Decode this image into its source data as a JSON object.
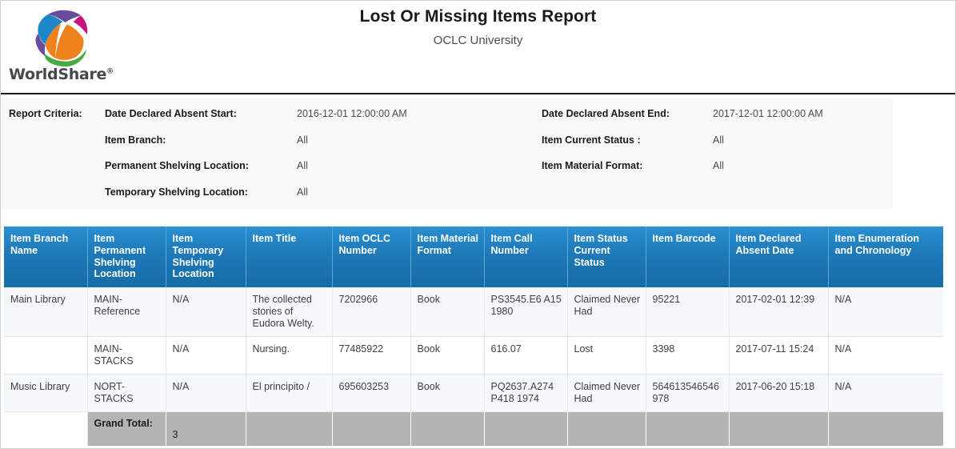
{
  "brand": {
    "name": "WorldShare",
    "trademark": "®",
    "logo_icon": "worldshare-globe-logo",
    "colors": {
      "blue": "#1b87c9",
      "orange": "#f0821e",
      "green": "#49a942",
      "purple": "#6b4c9a",
      "magenta": "#c4167e",
      "wordmark": "#44484d"
    }
  },
  "header": {
    "title": "Lost Or Missing Items Report",
    "subtitle": "OCLC University"
  },
  "criteria": {
    "label": "Report Criteria:",
    "left": [
      {
        "key": "Date Declared Absent Start:",
        "value": "2016-12-01 12:00:00 AM"
      },
      {
        "key": "Item Branch:",
        "value": "All"
      },
      {
        "key": "Permanent Shelving Location:",
        "value": "All"
      },
      {
        "key": "Temporary Shelving Location:",
        "value": "All"
      }
    ],
    "right": [
      {
        "key": "Date Declared Absent End:",
        "value": "2017-12-01 12:00:00 AM"
      },
      {
        "key": "Item Current Status :",
        "value": "All"
      },
      {
        "key": "Item Material Format:",
        "value": "All"
      }
    ]
  },
  "table": {
    "headers": [
      "Item Branch Name",
      "Item Permanent Shelving Location",
      "Item Temporary Shelving Location",
      "Item Title",
      "Item OCLC Number",
      "Item Material Format",
      "Item Call Number",
      "Item Status Current Status",
      "Item Barcode",
      "Item Declared Absent Date",
      "Item Enumeration and Chronology"
    ],
    "rows": [
      {
        "branch_name": "Main Library",
        "permanent_shelving_location": "MAIN-Reference",
        "temporary_shelving_location": "N/A",
        "title": "The collected stories of Eudora Welty.",
        "oclc_number": "7202966",
        "material_format": "Book",
        "call_number": "PS3545.E6 A15 1980",
        "current_status": "Claimed Never Had",
        "barcode": "95221",
        "declared_absent_date": "2017-02-01 12:39",
        "enumeration_chronology": "N/A"
      },
      {
        "branch_name": "",
        "permanent_shelving_location": "MAIN-STACKS",
        "temporary_shelving_location": "N/A",
        "title": "Nursing.",
        "oclc_number": "77485922",
        "material_format": "Book",
        "call_number": "616.07",
        "current_status": "Lost",
        "barcode": "3398",
        "declared_absent_date": "2017-07-11 15:24",
        "enumeration_chronology": "N/A"
      },
      {
        "branch_name": "Music Library",
        "permanent_shelving_location": "NORT-STACKS",
        "temporary_shelving_location": "N/A",
        "title": "El principito /",
        "oclc_number": "695603253",
        "material_format": "Book",
        "call_number": "PQ2637.A274 P418 1974",
        "current_status": "Claimed Never Had",
        "barcode": "564613546546978",
        "declared_absent_date": "2017-06-20 15:18",
        "enumeration_chronology": "N/A"
      }
    ],
    "total": {
      "label": "Grand Total:",
      "value": "3"
    }
  }
}
